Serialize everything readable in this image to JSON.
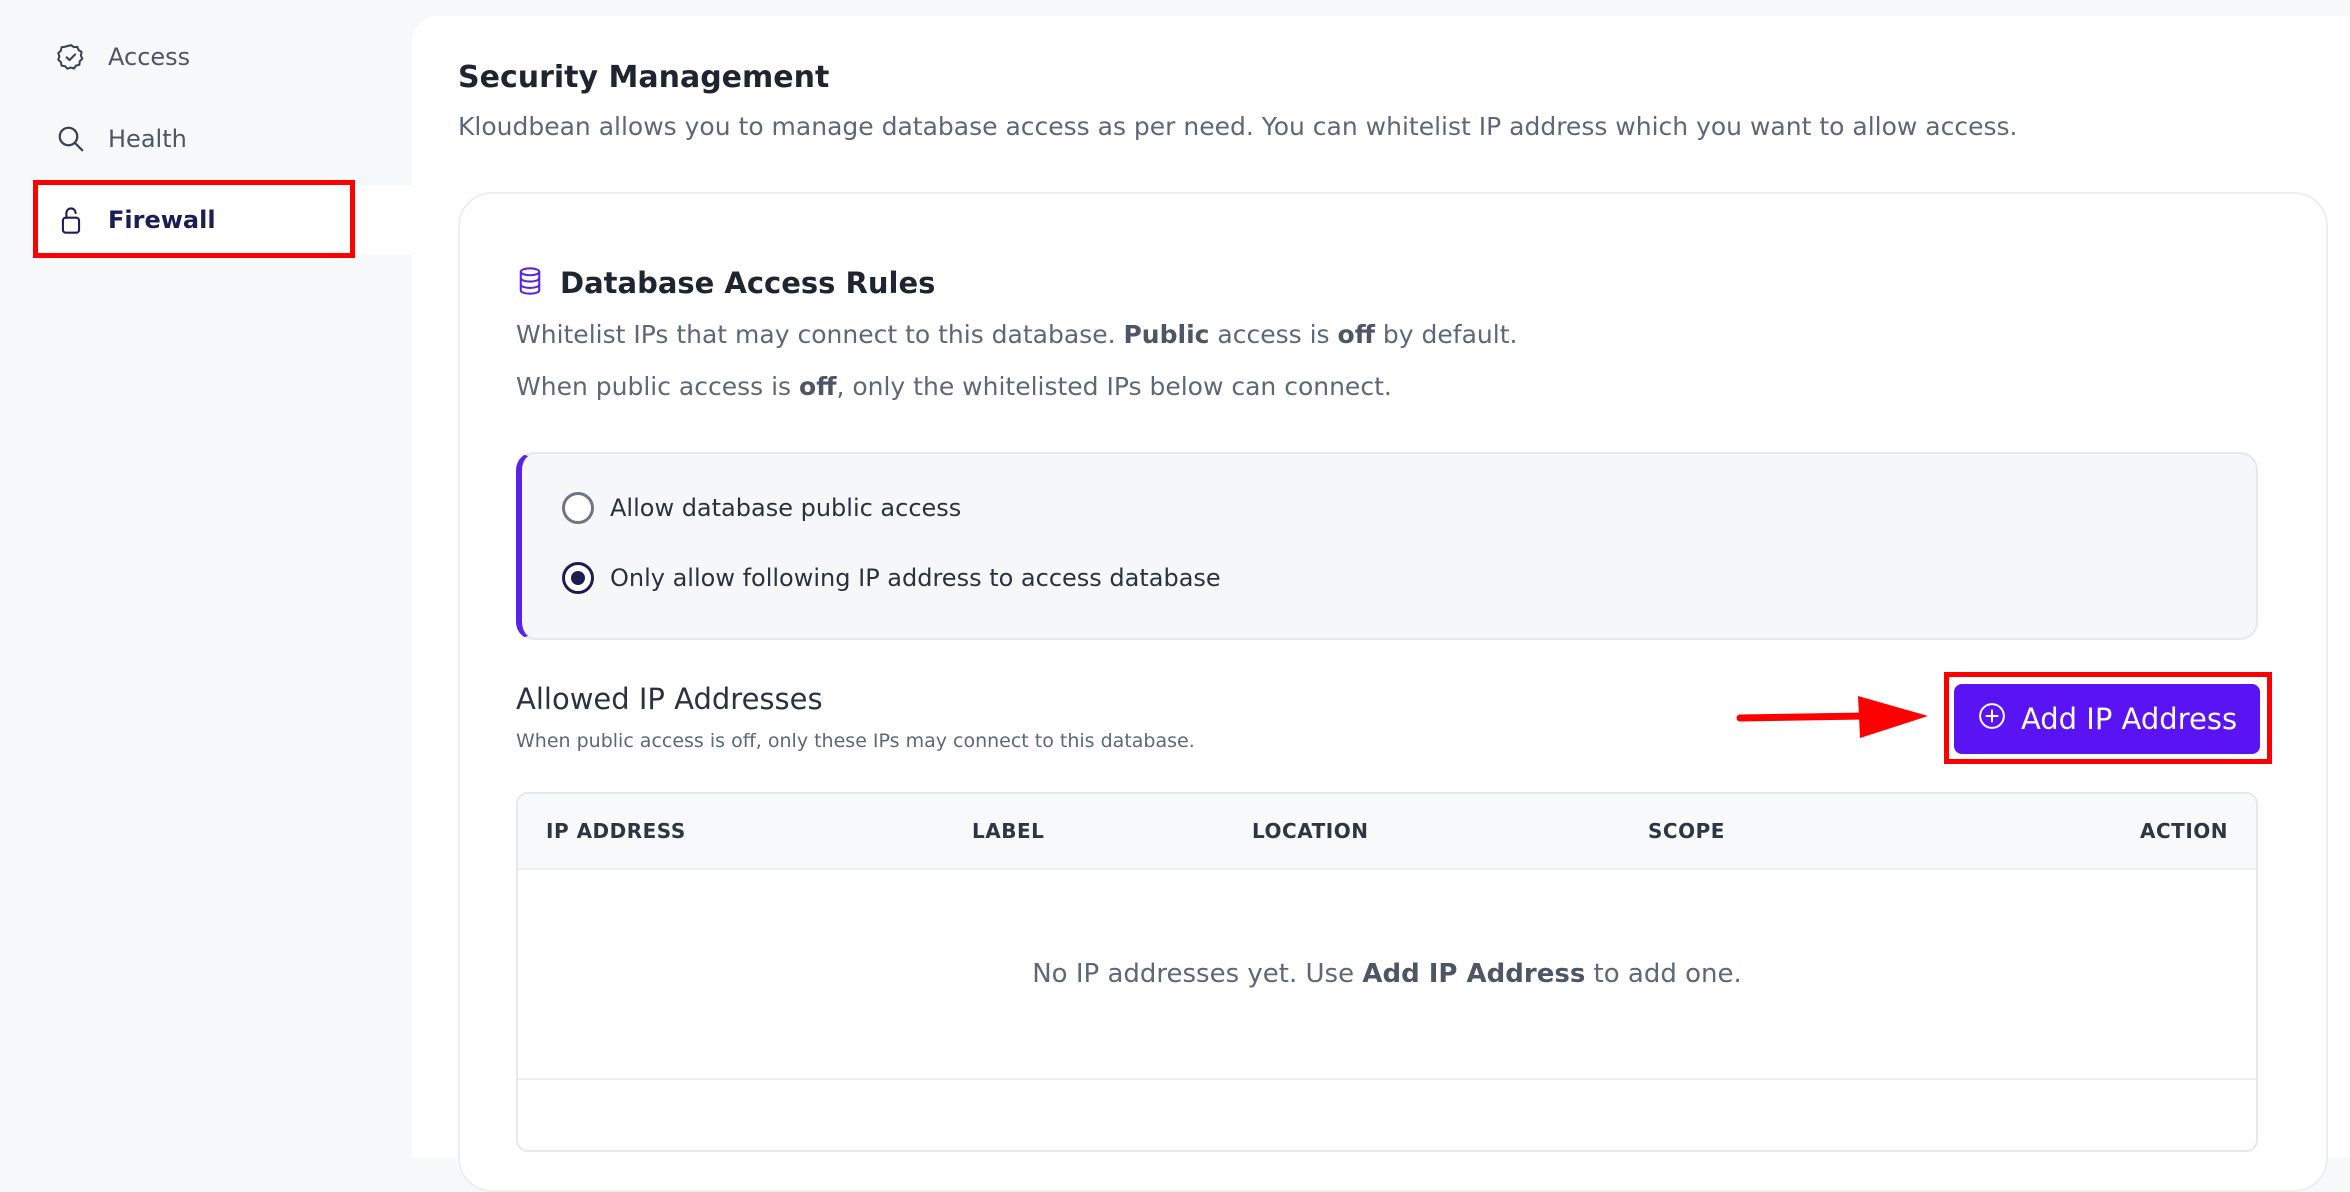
{
  "sidebar": {
    "items": [
      {
        "label": "Access",
        "icon": "badge-check-icon"
      },
      {
        "label": "Health",
        "icon": "search-icon"
      },
      {
        "label": "Firewall",
        "icon": "lock-icon",
        "active": true
      }
    ]
  },
  "header": {
    "title": "Security Management",
    "description": "Kloudbean allows you to manage database access as per need. You can whitelist IP address which you want to allow access."
  },
  "rules": {
    "icon": "database-icon",
    "title": "Database Access Rules",
    "line1": {
      "pre": "Whitelist IPs that may connect to this database. ",
      "b1": "Public",
      "mid": " access is ",
      "b2": "off",
      "post": " by default."
    },
    "line2": {
      "pre": "When public access is ",
      "b1": "off",
      "post": ", only the whitelisted IPs below can connect."
    },
    "options": [
      {
        "label": "Allow database public access",
        "checked": false
      },
      {
        "label": "Only allow following IP address to access database",
        "checked": true
      }
    ]
  },
  "allowed": {
    "title": "Allowed IP Addresses",
    "subtitle": "When public access is off, only these IPs may connect to this database.",
    "add_button": "Add IP Address",
    "columns": [
      "IP ADDRESS",
      "LABEL",
      "LOCATION",
      "SCOPE",
      "ACTION"
    ],
    "empty": {
      "pre": "No IP addresses yet. Use ",
      "b": "Add IP Address",
      "post": " to add one."
    }
  },
  "colors": {
    "accent": "#5a13f3",
    "highlight": "#ff0000",
    "nav_active": "#1b1e54"
  }
}
